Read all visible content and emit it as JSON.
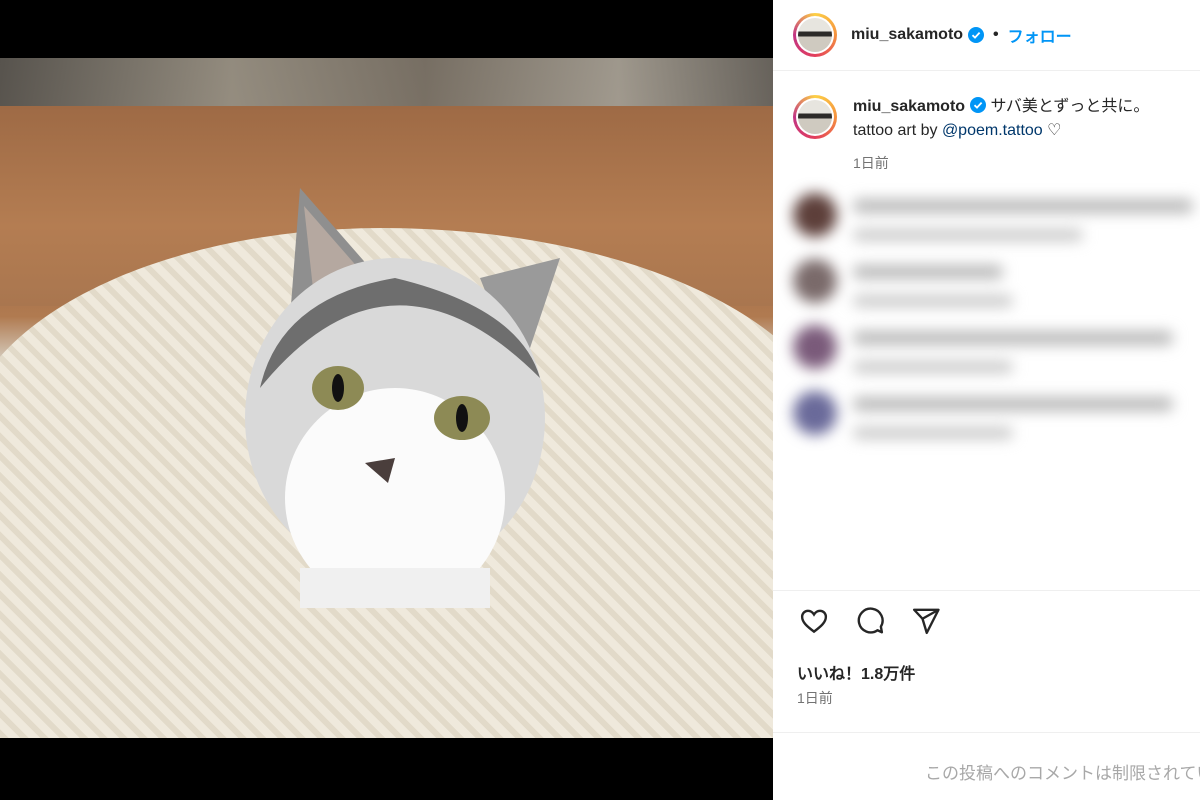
{
  "post": {
    "username": "miu_sakamoto",
    "separator": "•",
    "follow_label": "フォロー",
    "caption_text": "サバ美とずっと共に。",
    "caption_line2_prefix": "tattoo art by ",
    "caption_mention": "@poem.tattoo",
    "caption_suffix": " ♡",
    "caption_time": "1日前",
    "likes": "いいね！1.8万件",
    "post_time": "1日前",
    "comments_limited": "この投稿へのコメントは制限されています"
  },
  "icons": {
    "verified": "verified-badge-icon",
    "like": "heart-icon",
    "comment": "comment-bubble-icon",
    "share": "paper-plane-icon"
  },
  "colors": {
    "follow": "#0095f6",
    "mention": "#00376b",
    "verified": "#0095f6",
    "muted": "#737373"
  },
  "carousel": {
    "slides": 2,
    "active": 2
  }
}
